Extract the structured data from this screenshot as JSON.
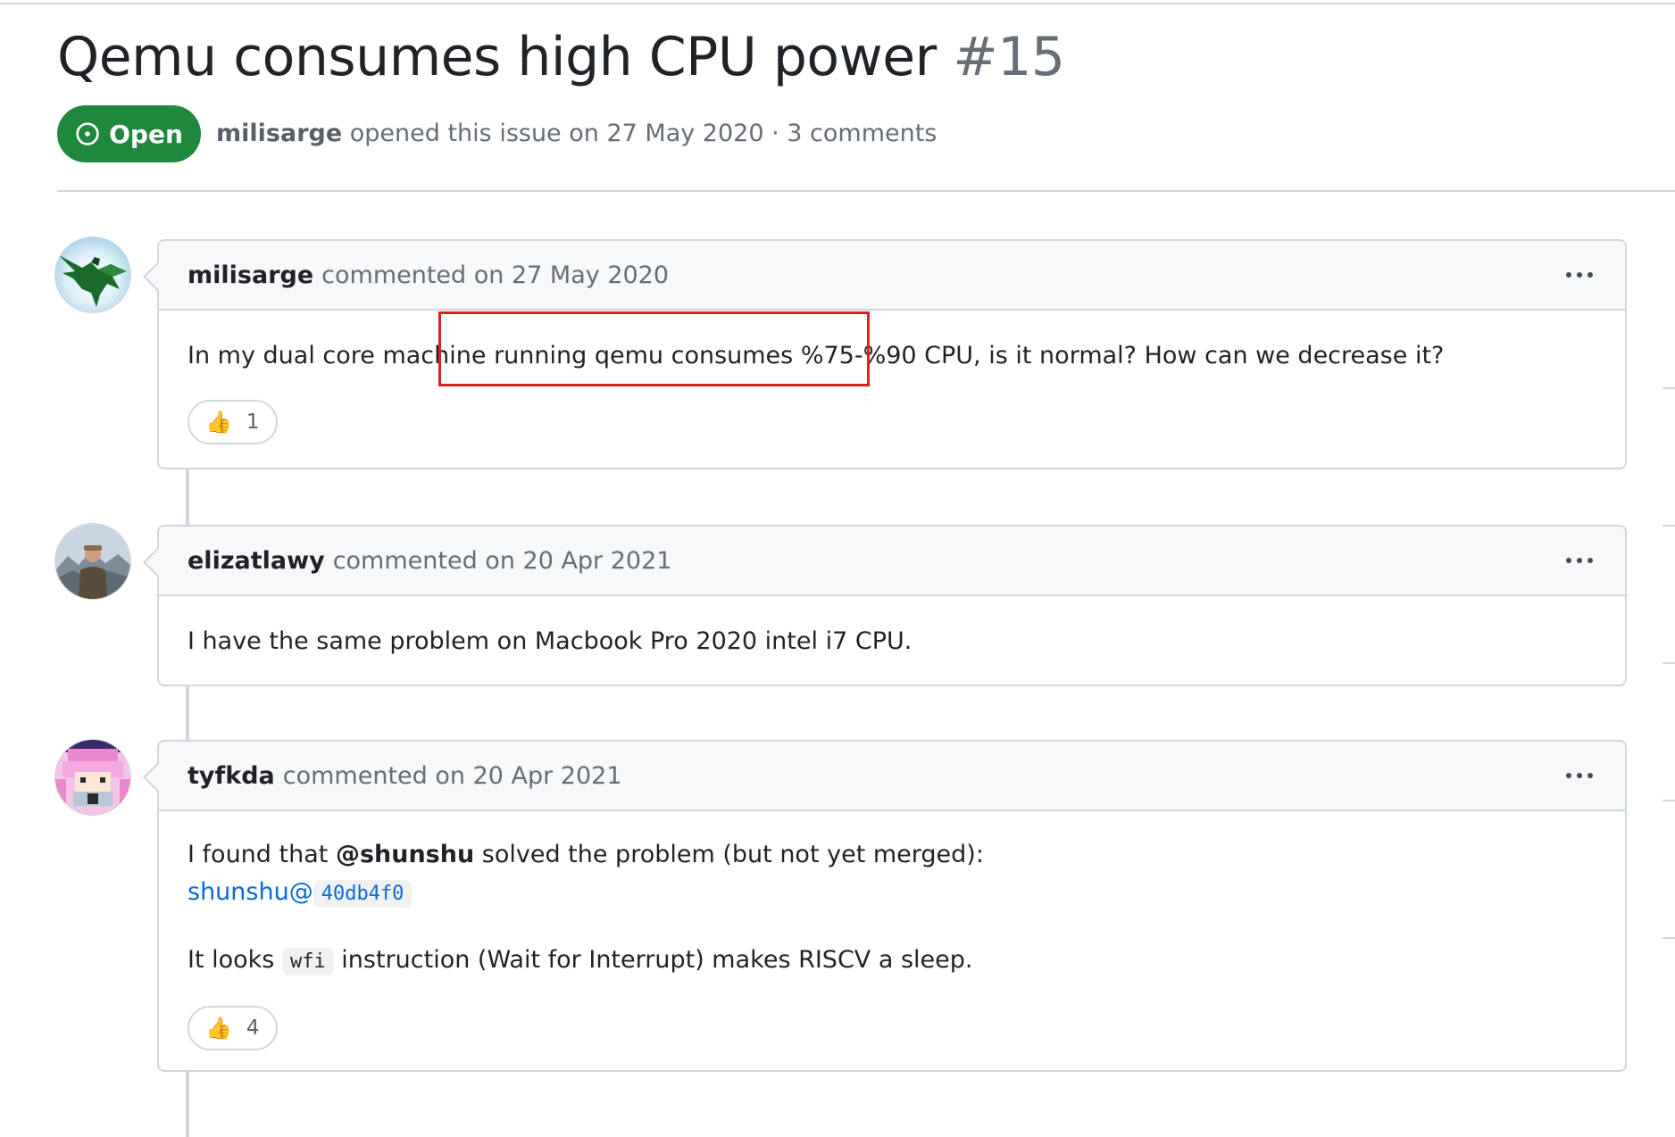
{
  "issue": {
    "title": "Qemu consumes high CPU power",
    "number": "#15",
    "state": "Open",
    "author": "milisarge",
    "opened_text": "opened this issue on 27 May 2020 · 3 comments"
  },
  "comments": [
    {
      "author": "milisarge",
      "meta": "commented on 27 May 2020",
      "body_pre": "In my dual core machine ",
      "body_highlight": "running qemu consumes %75-%90 CPU,",
      "body_post": " is it normal? How can we decrease it?",
      "reaction_icon": "👍",
      "reaction_count": "1"
    },
    {
      "author": "elizatlawy",
      "meta": "commented on 20 Apr 2021",
      "body": "I have the same problem on Macbook Pro 2020 intel i7 CPU."
    },
    {
      "author": "tyfkda",
      "meta": "commented on 20 Apr 2021",
      "line1_pre": "I found that ",
      "line1_mention": "@shunshu",
      "line1_post": " solved the problem (but not yet merged):",
      "link_text": "shunshu@",
      "commit_sha": "40db4f0",
      "line3_pre": "It looks ",
      "line3_code": "wfi",
      "line3_post": " instruction (Wait for Interrupt) makes RISCV a sleep.",
      "reaction_icon": "👍",
      "reaction_count": "4"
    }
  ],
  "colors": {
    "open_green": "#1f883d",
    "highlight_red": "#e0201e",
    "link_blue": "#0969da"
  }
}
